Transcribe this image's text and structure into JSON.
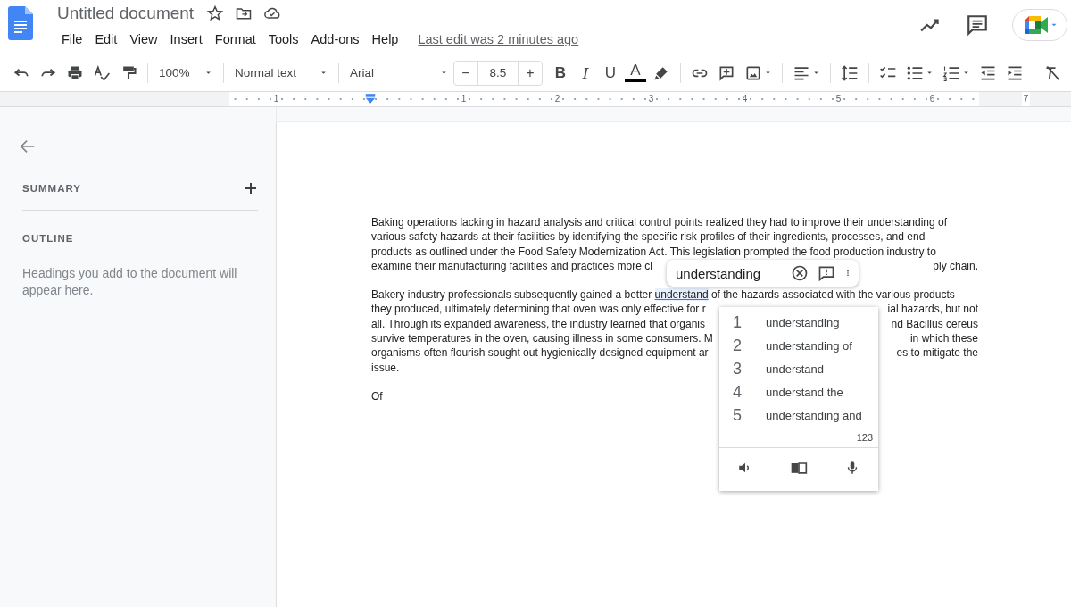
{
  "app_bar": {
    "title": "Untitled document",
    "menu": [
      "File",
      "Edit",
      "View",
      "Insert",
      "Format",
      "Tools",
      "Add-ons",
      "Help"
    ],
    "last_edit": "Last edit was 2 minutes ago"
  },
  "toolbar": {
    "zoom": "100%",
    "style": "Normal text",
    "font": "Arial",
    "font_size": {
      "decrease": "−",
      "value": "8.5",
      "increase": "+"
    },
    "format_buttons": [
      {
        "kind": "bold",
        "label": "B"
      },
      {
        "kind": "italic",
        "label": "I"
      },
      {
        "kind": "underline",
        "label": "U"
      },
      {
        "kind": "text_color",
        "label": "A"
      }
    ]
  },
  "ruler": {
    "labels": [
      "1",
      "1",
      "2",
      "3",
      "4",
      "5",
      "6",
      "7"
    ]
  },
  "sidebar": {
    "summary": "SUMMARY",
    "outline": "OUTLINE",
    "hint": "Headings you add to the document will appear here."
  },
  "document": {
    "paragraphs": [
      {
        "lines": [
          {
            "segments": [
              {
                "text": "Baking operations lacking in hazard analysis and critical control points realized they had to improve their understanding of",
                "flagged": false
              }
            ]
          },
          {
            "segments": [
              {
                "text": "various safety hazards at their facilities by identifying the specific risk profiles of their ingredients, processes, and end",
                "flagged": false
              }
            ]
          },
          {
            "segments": [
              {
                "text": "products as outlined under the Food Safety Modernization Act. This legislation prompted the food production industry to",
                "flagged": false
              }
            ]
          },
          {
            "segments": [
              {
                "text": "examine their manufacturing facilities and practices more cl",
                "flagged": false
              }
            ],
            "right": "ply chain."
          }
        ]
      },
      {
        "lines": [
          {
            "segments": [
              {
                "text": "Bakery industry professionals subsequently gained a better ",
                "flagged": false
              },
              {
                "text": "understand",
                "flagged": true
              },
              {
                "text": " of the hazards associated with the various products",
                "flagged": false
              }
            ]
          },
          {
            "segments": [
              {
                "text": "they produced, ultimately determining that oven was only effective for r",
                "flagged": false
              }
            ],
            "right": "ial hazards, but not"
          },
          {
            "segments": [
              {
                "text": "all. Through its expanded awareness, the industry learned that organis",
                "flagged": false
              }
            ],
            "right": "nd Bacillus cereus"
          },
          {
            "segments": [
              {
                "text": "survive temperatures in the oven, causing illness in some consumers. M",
                "flagged": false
              }
            ],
            "right": "in which these"
          },
          {
            "segments": [
              {
                "text": "organisms often flourish sought out hygienically designed equipment ar",
                "flagged": false
              }
            ],
            "right": "es to mitigate the"
          },
          {
            "segments": [
              {
                "text": "issue.",
                "flagged": false
              }
            ]
          }
        ]
      },
      {
        "lines": [
          {
            "segments": [
              {
                "text": "Of",
                "flagged": false
              }
            ]
          }
        ]
      }
    ]
  },
  "spelling_popup": {
    "word": "understanding"
  },
  "suggestions": {
    "items": [
      {
        "number": "1",
        "text": "understanding"
      },
      {
        "number": "2",
        "text": "understanding of"
      },
      {
        "number": "3",
        "text": "understand"
      },
      {
        "number": "4",
        "text": "understand the"
      },
      {
        "number": "5",
        "text": "understanding and"
      }
    ],
    "count": "123"
  }
}
